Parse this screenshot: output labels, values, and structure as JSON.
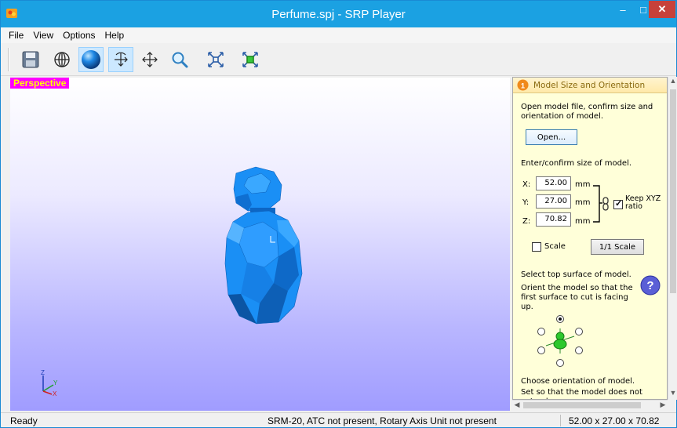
{
  "window": {
    "title": "Perfume.spj - SRP Player"
  },
  "window_controls": {
    "minimize": "–",
    "maximize": "□",
    "close": "✕"
  },
  "menu": [
    "File",
    "View",
    "Options",
    "Help"
  ],
  "toolbar": {
    "buttons": [
      {
        "name": "save",
        "icon": "floppy-disk-icon",
        "active": false
      },
      {
        "name": "wireframe",
        "icon": "globe-wireframe-icon",
        "active": false
      },
      {
        "name": "shaded",
        "icon": "shaded-sphere-icon",
        "active": true
      },
      {
        "name": "rotate",
        "icon": "rotate-arrows-icon",
        "active": true
      },
      {
        "name": "pan",
        "icon": "move-arrows-icon",
        "active": false
      },
      {
        "name": "zoom",
        "icon": "magnifier-icon",
        "active": false
      },
      {
        "name": "fit",
        "icon": "fit-to-window-icon",
        "active": false
      },
      {
        "name": "model-fit",
        "icon": "model-fit-icon",
        "active": false
      }
    ]
  },
  "viewport": {
    "label": "Perspective",
    "axis_labels": {
      "z": "Z",
      "y": "Y",
      "x": "X"
    }
  },
  "panel": {
    "header_title": "Model Size and Orientation",
    "open_instructions": "Open model file, confirm size and orientation of model.",
    "open_button": "Open...",
    "size_instructions": "Enter/confirm size of model.",
    "size": {
      "x_label": "X:",
      "x_value": "52.00",
      "y_label": "Y:",
      "y_value": "27.00",
      "z_label": "Z:",
      "z_value": "70.82",
      "unit": "mm"
    },
    "keep_ratio_label": "Keep XYZ ratio",
    "keep_ratio_checked": true,
    "scale_label": "Scale",
    "scale_checked": false,
    "one_to_one_button": "1/1 Scale",
    "top_surface_title": "Select top surface of model.",
    "top_surface_instructions": "Orient the model so that the first surface to cut is facing up.",
    "orientation_title": "Choose orientation of model.",
    "orientation_instructions": "Set so that the model does not extend"
  },
  "status": {
    "left": "Ready",
    "machine": "SRM-20, ATC not present, Rotary Axis Unit not present",
    "size": "52.00 x 27.00 x 70.82"
  },
  "colors": {
    "titlebar": "#1ba1e2",
    "close_button": "#c7413a",
    "perspective_label_bg": "#ff00ff",
    "perspective_label_fg": "#ffff00",
    "model": "#1e90ff",
    "panel_bg": "#ffffd9"
  }
}
